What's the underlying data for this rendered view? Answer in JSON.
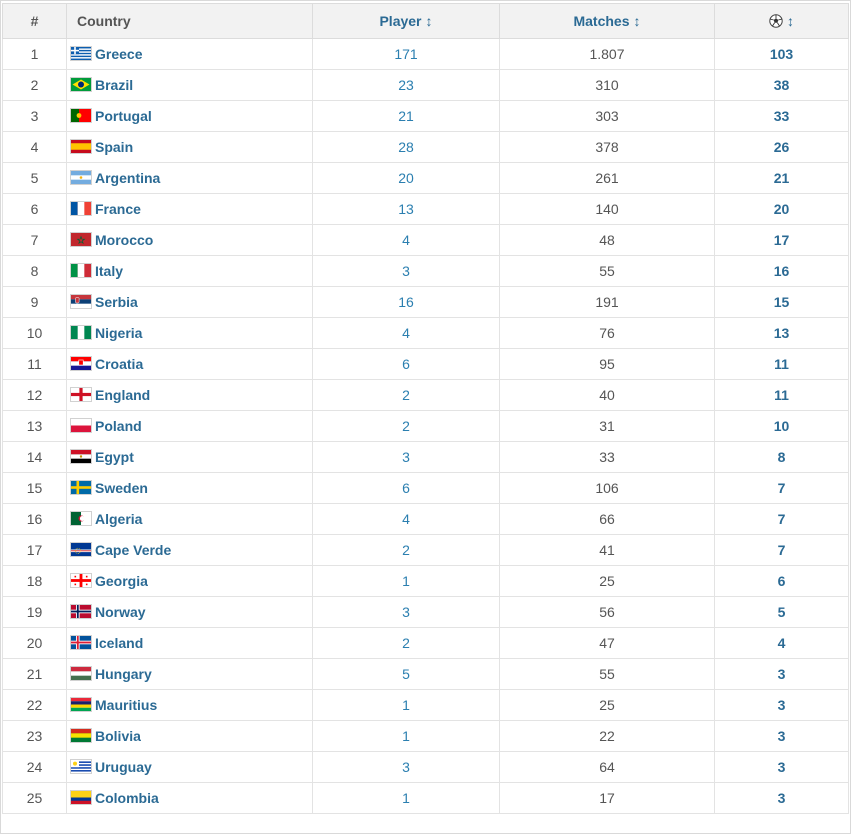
{
  "header": {
    "rank": "#",
    "country": "Country",
    "players": "Player",
    "matches": "Matches",
    "sort_arrow": "↕",
    "goals_icon": "soccer-ball-icon"
  },
  "rows": [
    {
      "rank": "1",
      "country": "Greece",
      "flag": "greece",
      "players": "171",
      "matches": "1.807",
      "goals": "103"
    },
    {
      "rank": "2",
      "country": "Brazil",
      "flag": "brazil",
      "players": "23",
      "matches": "310",
      "goals": "38"
    },
    {
      "rank": "3",
      "country": "Portugal",
      "flag": "portugal",
      "players": "21",
      "matches": "303",
      "goals": "33"
    },
    {
      "rank": "4",
      "country": "Spain",
      "flag": "spain",
      "players": "28",
      "matches": "378",
      "goals": "26"
    },
    {
      "rank": "5",
      "country": "Argentina",
      "flag": "argentina",
      "players": "20",
      "matches": "261",
      "goals": "21"
    },
    {
      "rank": "6",
      "country": "France",
      "flag": "france",
      "players": "13",
      "matches": "140",
      "goals": "20"
    },
    {
      "rank": "7",
      "country": "Morocco",
      "flag": "morocco",
      "players": "4",
      "matches": "48",
      "goals": "17"
    },
    {
      "rank": "8",
      "country": "Italy",
      "flag": "italy",
      "players": "3",
      "matches": "55",
      "goals": "16"
    },
    {
      "rank": "9",
      "country": "Serbia",
      "flag": "serbia",
      "players": "16",
      "matches": "191",
      "goals": "15"
    },
    {
      "rank": "10",
      "country": "Nigeria",
      "flag": "nigeria",
      "players": "4",
      "matches": "76",
      "goals": "13"
    },
    {
      "rank": "11",
      "country": "Croatia",
      "flag": "croatia",
      "players": "6",
      "matches": "95",
      "goals": "11"
    },
    {
      "rank": "12",
      "country": "England",
      "flag": "england",
      "players": "2",
      "matches": "40",
      "goals": "11"
    },
    {
      "rank": "13",
      "country": "Poland",
      "flag": "poland",
      "players": "2",
      "matches": "31",
      "goals": "10"
    },
    {
      "rank": "14",
      "country": "Egypt",
      "flag": "egypt",
      "players": "3",
      "matches": "33",
      "goals": "8"
    },
    {
      "rank": "15",
      "country": "Sweden",
      "flag": "sweden",
      "players": "6",
      "matches": "106",
      "goals": "7"
    },
    {
      "rank": "16",
      "country": "Algeria",
      "flag": "algeria",
      "players": "4",
      "matches": "66",
      "goals": "7"
    },
    {
      "rank": "17",
      "country": "Cape Verde",
      "flag": "cape-verde",
      "players": "2",
      "matches": "41",
      "goals": "7"
    },
    {
      "rank": "18",
      "country": "Georgia",
      "flag": "georgia",
      "players": "1",
      "matches": "25",
      "goals": "6"
    },
    {
      "rank": "19",
      "country": "Norway",
      "flag": "norway",
      "players": "3",
      "matches": "56",
      "goals": "5"
    },
    {
      "rank": "20",
      "country": "Iceland",
      "flag": "iceland",
      "players": "2",
      "matches": "47",
      "goals": "4"
    },
    {
      "rank": "21",
      "country": "Hungary",
      "flag": "hungary",
      "players": "5",
      "matches": "55",
      "goals": "3"
    },
    {
      "rank": "22",
      "country": "Mauritius",
      "flag": "mauritius",
      "players": "1",
      "matches": "25",
      "goals": "3"
    },
    {
      "rank": "23",
      "country": "Bolivia",
      "flag": "bolivia",
      "players": "1",
      "matches": "22",
      "goals": "3"
    },
    {
      "rank": "24",
      "country": "Uruguay",
      "flag": "uruguay",
      "players": "3",
      "matches": "64",
      "goals": "3"
    },
    {
      "rank": "25",
      "country": "Colombia",
      "flag": "colombia",
      "players": "1",
      "matches": "17",
      "goals": "3"
    }
  ],
  "colors": {
    "link": "#2b6a94",
    "players_text": "#2b7fb0",
    "header_bg": "#f2f2f2",
    "grid": "#e3e3e3"
  }
}
